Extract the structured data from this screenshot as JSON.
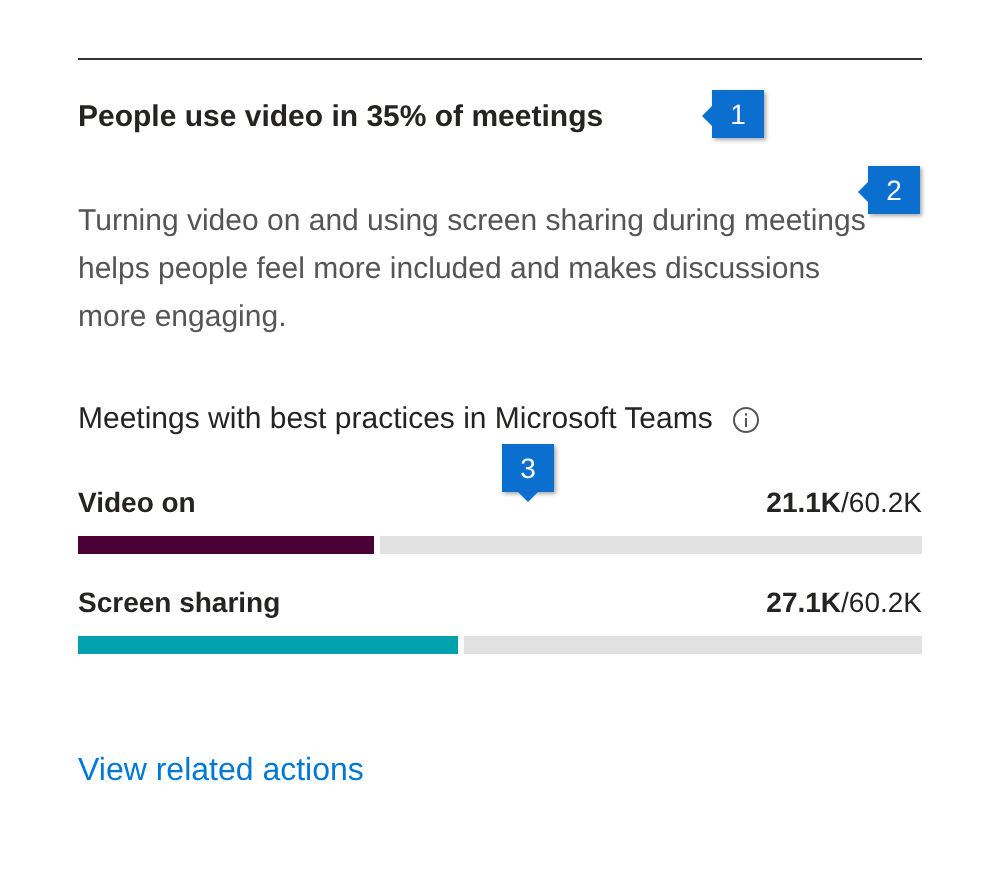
{
  "title": "People use video in 35% of meetings",
  "description": "Turning video on and using screen sharing during meetings helps people feel more included and makes discussions more engaging.",
  "metrics": {
    "heading": "Meetings with best practices in Microsoft Teams",
    "rows": [
      {
        "label": "Video on",
        "value": "**21.1K**/60.2K",
        "level": 0.35,
        "color": "#4b0036"
      },
      {
        "label": "Screen sharing",
        "value": "**27.1K**/60.2K",
        "level": 0.45,
        "color": "#00a2ad"
      }
    ]
  },
  "link": "View related actions",
  "callouts": [
    {
      "text": "1"
    },
    {
      "text": "2"
    },
    {
      "text": "3"
    }
  ]
}
